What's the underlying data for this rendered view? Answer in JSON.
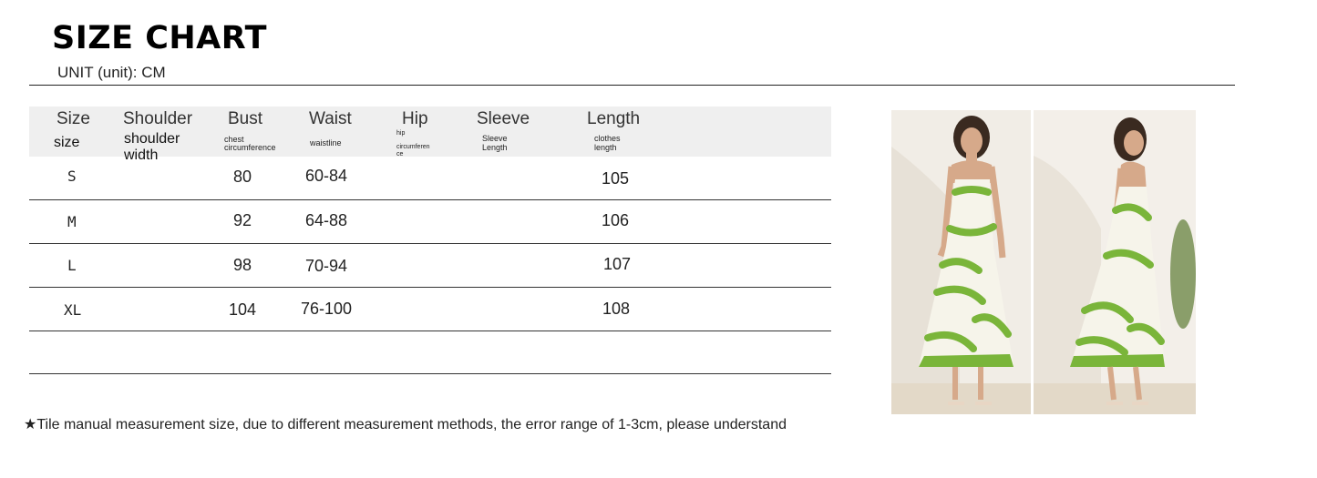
{
  "title": "SIZE CHART",
  "unit": "UNIT (unit): CM",
  "headers": {
    "size": {
      "en": "Size",
      "cn": "size"
    },
    "shoulder": {
      "en": "Shoulder",
      "cn": "shoulder",
      "cn2": "width"
    },
    "bust": {
      "en": "Bust",
      "sub1": "chest",
      "sub2": "circumference"
    },
    "waist": {
      "en": "Waist",
      "sub": "waistline"
    },
    "hip": {
      "en": "Hip",
      "sub1": "hip",
      "sub2": "circumferen",
      "sub3": "ce"
    },
    "sleeve": {
      "en": "Sleeve",
      "sub1": "Sleeve",
      "sub2": "Length"
    },
    "length": {
      "en": "Length",
      "sub1": "clothes",
      "sub2": "length"
    }
  },
  "rows": [
    {
      "size": "S",
      "bust": "80",
      "waist": "60-84",
      "length": "105"
    },
    {
      "size": "M",
      "bust": "92",
      "waist": "64-88",
      "length": "106"
    },
    {
      "size": "L",
      "bust": "98",
      "waist": "70-94",
      "length": "107"
    },
    {
      "size": "XL",
      "bust": "104",
      "waist": "76-100",
      "length": "108"
    }
  ],
  "note": "★Tile manual measurement size, due to different measurement methods, the error range of 1-3cm, please understand",
  "colors": {
    "dress_green": "#7ab53a",
    "header_bg": "#efefef"
  }
}
